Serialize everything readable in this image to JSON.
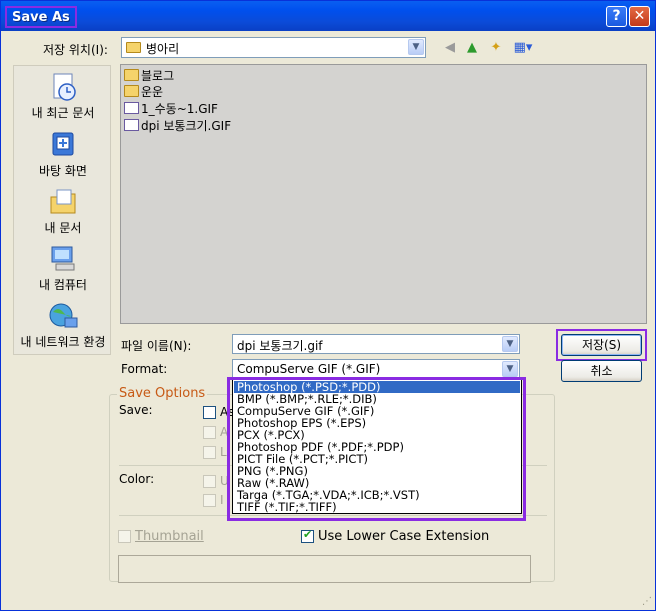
{
  "window": {
    "title": "Save As",
    "help_label": "?",
    "close_label": "✕"
  },
  "location": {
    "label": "저장 위치(I):",
    "value": "병아리"
  },
  "places": [
    {
      "label": "내 최근 문서",
      "icon": "recent-documents-icon"
    },
    {
      "label": "바탕 화면",
      "icon": "desktop-icon"
    },
    {
      "label": "내 문서",
      "icon": "my-documents-icon"
    },
    {
      "label": "내 컴퓨터",
      "icon": "my-computer-icon"
    },
    {
      "label": "내 네트워크 환경",
      "icon": "network-icon"
    }
  ],
  "files": [
    {
      "name": "블로그",
      "type": "folder"
    },
    {
      "name": "운운",
      "type": "folder"
    },
    {
      "name": "1_수동~1.GIF",
      "type": "gif"
    },
    {
      "name": "dpi 보통크기.GIF",
      "type": "gif"
    }
  ],
  "filename": {
    "label": "파일 이름(N):",
    "value": "dpi 보통크기.gif"
  },
  "format": {
    "label": "Format:",
    "value": "CompuServe GIF (*.GIF)",
    "options": [
      "Photoshop (*.PSD;*.PDD)",
      "BMP (*.BMP;*.RLE;*.DIB)",
      "CompuServe GIF (*.GIF)",
      "Photoshop EPS (*.EPS)",
      "PCX (*.PCX)",
      "Photoshop PDF (*.PDF;*.PDP)",
      "PICT File (*.PCT;*.PICT)",
      "PNG (*.PNG)",
      "Raw (*.RAW)",
      "Targa (*.TGA;*.VDA;*.ICB;*.VST)",
      "TIFF (*.TIF;*.TIFF)"
    ],
    "highlighted_index": 0
  },
  "buttons": {
    "save": "저장(S)",
    "cancel": "취소"
  },
  "save_options": {
    "title": "Save Options",
    "save_label": "Save:",
    "color_label": "Color:",
    "save_as_copy_fragment": "As",
    "alpha_fragment": "A",
    "layers_fragment": "L",
    "color_use_fragment": "U",
    "icc_fragment": "I",
    "thumbnail_label": "Thumbnail",
    "lowercase_label": "Use Lower Case Extension",
    "lowercase_checked": true
  },
  "colors": {
    "title_bar": "#0050ee",
    "highlight": "#8a2be2",
    "selection": "#316ac5",
    "group_title": "#c75a16"
  }
}
